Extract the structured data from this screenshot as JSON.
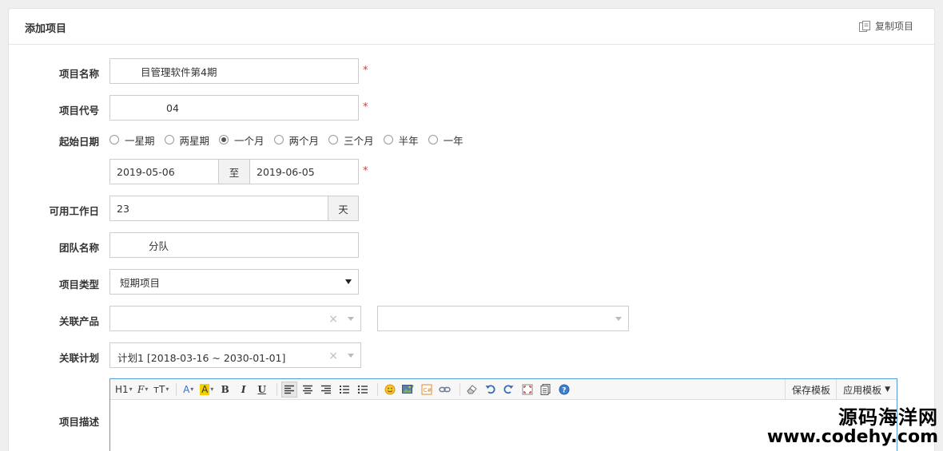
{
  "panel": {
    "title": "添加项目",
    "copy_label": "复制项目"
  },
  "form": {
    "name": {
      "label": "项目名称",
      "value": "目管理软件第4期",
      "required": "*"
    },
    "code": {
      "label": "项目代号",
      "value": "04",
      "required": "*"
    },
    "date": {
      "label": "起始日期",
      "options": [
        "一星期",
        "两星期",
        "一个月",
        "两个月",
        "三个月",
        "半年",
        "一年"
      ],
      "selected": "一个月",
      "start": "2019-05-06",
      "to_label": "至",
      "end": "2019-06-05",
      "required": "*"
    },
    "workdays": {
      "label": "可用工作日",
      "value": "23",
      "unit": "天"
    },
    "team": {
      "label": "团队名称",
      "value": "分队"
    },
    "type": {
      "label": "项目类型",
      "value": "短期项目"
    },
    "product": {
      "label": "关联产品",
      "clear": "×"
    },
    "plan": {
      "label": "关联计划",
      "value": "计划1 [2018-03-16 ~ 2030-01-01]",
      "clear": "×"
    },
    "desc": {
      "label": "项目描述",
      "toolbar": {
        "heading": "H1",
        "font": "F",
        "size": "тT",
        "font_color": "A",
        "bg_color": "A",
        "bold": "B",
        "italic": "I",
        "underline": "U",
        "save_template": "保存模板",
        "apply_template": "应用模板"
      }
    }
  },
  "watermark": {
    "line1": "源码海洋网",
    "line2": "www.codehy.com"
  },
  "colors": {
    "required": "#ee3333",
    "editor_border": "#5a9ad8",
    "highlight": "#f5d000"
  }
}
